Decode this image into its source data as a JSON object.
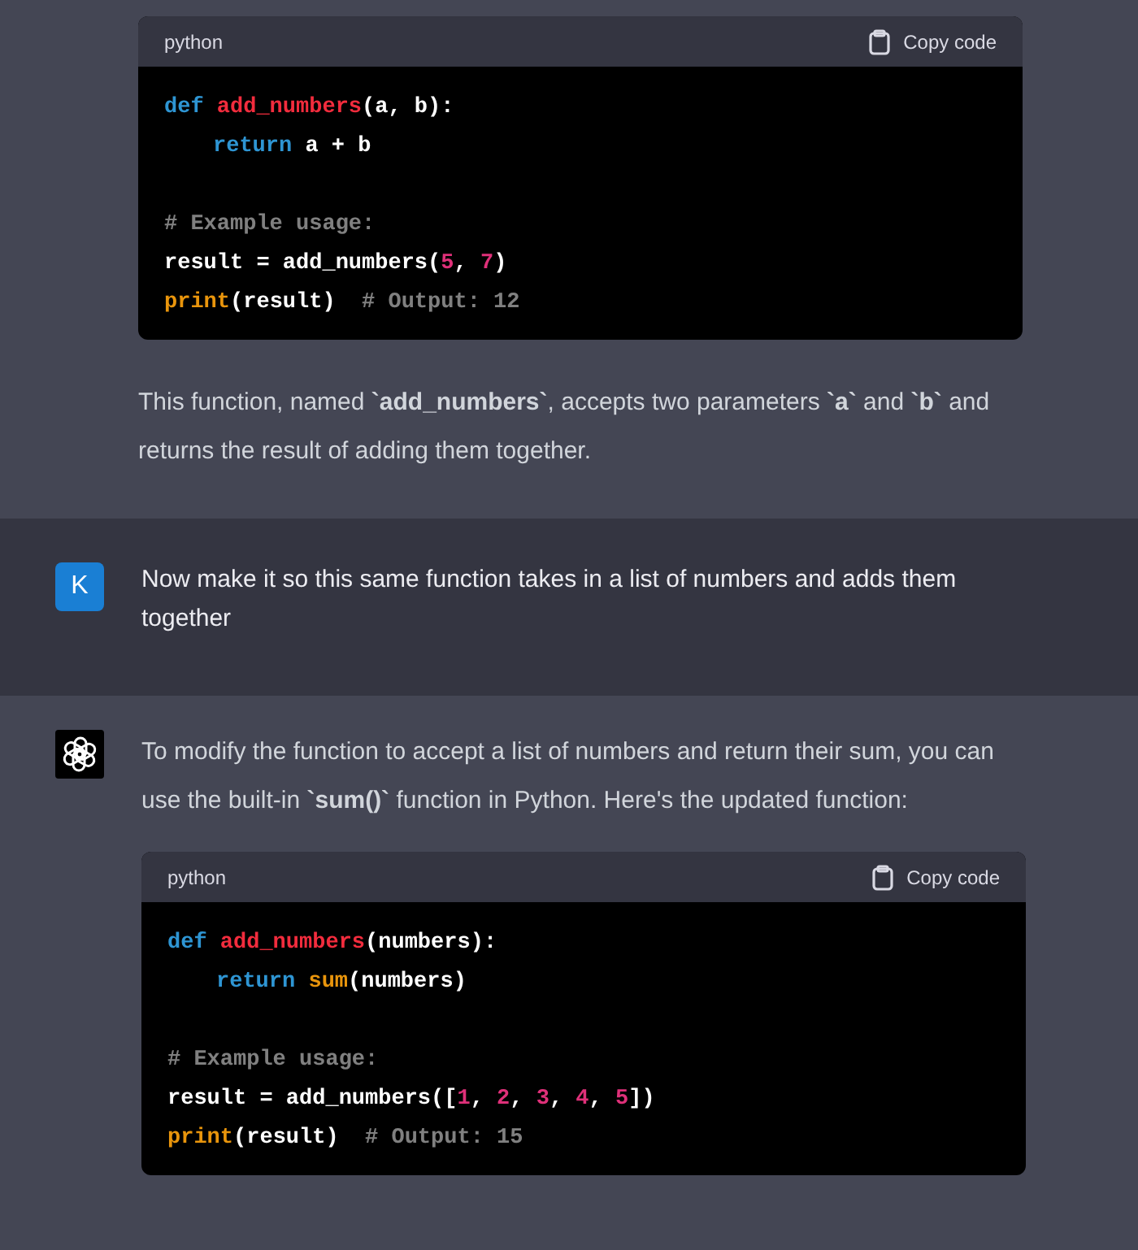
{
  "messages": [
    {
      "kind": "assistant",
      "blocks": [
        {
          "kind": "code",
          "language": "python",
          "copy_label": "Copy code",
          "lines": [
            {
              "kind": "code",
              "tokens": [
                {
                  "kind": "keyword",
                  "text": "def "
                },
                {
                  "kind": "function",
                  "text": "add_numbers"
                },
                {
                  "kind": "plain",
                  "text": "(a, b):"
                }
              ]
            },
            {
              "kind": "indented",
              "tokens": [
                {
                  "kind": "keyword",
                  "text": "return"
                },
                {
                  "kind": "plain",
                  "text": " a + b"
                }
              ]
            },
            {
              "kind": "blank"
            },
            {
              "kind": "code",
              "tokens": [
                {
                  "kind": "comment",
                  "text": "# Example usage:"
                }
              ]
            },
            {
              "kind": "code",
              "tokens": [
                {
                  "kind": "plain",
                  "text": "result = add_numbers("
                },
                {
                  "kind": "number",
                  "text": "5"
                },
                {
                  "kind": "plain",
                  "text": ", "
                },
                {
                  "kind": "number",
                  "text": "7"
                },
                {
                  "kind": "plain",
                  "text": ")"
                }
              ]
            },
            {
              "kind": "code",
              "tokens": [
                {
                  "kind": "builtin",
                  "text": "print"
                },
                {
                  "kind": "plain",
                  "text": "(result)  "
                },
                {
                  "kind": "comment",
                  "text": "# Output: 12"
                }
              ]
            }
          ]
        },
        {
          "kind": "paragraph",
          "text": "This function, named **`add_numbers`**, accepts two parameters **`a`** and **`b`** and returns the result of adding them together."
        }
      ]
    },
    {
      "kind": "user",
      "avatar": {
        "kind": "letter",
        "letter": "K"
      },
      "blocks": [
        {
          "kind": "paragraph",
          "text": "Now make it so this same function takes in a list of numbers and adds them together"
        }
      ]
    },
    {
      "kind": "assistant",
      "avatar": {
        "kind": "logo"
      },
      "blocks": [
        {
          "kind": "paragraph",
          "text": "To modify the function to accept a list of numbers and return their sum, you can use the built-in **`sum()`** function in Python. Here's the updated function:"
        },
        {
          "kind": "code",
          "language": "python",
          "copy_label": "Copy code",
          "lines": [
            {
              "kind": "code",
              "tokens": [
                {
                  "kind": "keyword",
                  "text": "def "
                },
                {
                  "kind": "function",
                  "text": "add_numbers"
                },
                {
                  "kind": "plain",
                  "text": "(numbers):"
                }
              ]
            },
            {
              "kind": "indented",
              "tokens": [
                {
                  "kind": "keyword",
                  "text": "return "
                },
                {
                  "kind": "builtin",
                  "text": "sum"
                },
                {
                  "kind": "plain",
                  "text": "(numbers)"
                }
              ]
            },
            {
              "kind": "blank"
            },
            {
              "kind": "code",
              "tokens": [
                {
                  "kind": "comment",
                  "text": "# Example usage:"
                }
              ]
            },
            {
              "kind": "code",
              "tokens": [
                {
                  "kind": "plain",
                  "text": "result = add_numbers(["
                },
                {
                  "kind": "number",
                  "text": "1"
                },
                {
                  "kind": "plain",
                  "text": ", "
                },
                {
                  "kind": "number",
                  "text": "2"
                },
                {
                  "kind": "plain",
                  "text": ", "
                },
                {
                  "kind": "number",
                  "text": "3"
                },
                {
                  "kind": "plain",
                  "text": ", "
                },
                {
                  "kind": "number",
                  "text": "4"
                },
                {
                  "kind": "plain",
                  "text": ", "
                },
                {
                  "kind": "number",
                  "text": "5"
                },
                {
                  "kind": "plain",
                  "text": "])"
                }
              ]
            },
            {
              "kind": "code",
              "tokens": [
                {
                  "kind": "builtin",
                  "text": "print"
                },
                {
                  "kind": "plain",
                  "text": "(result)  "
                },
                {
                  "kind": "comment",
                  "text": "# Output: 15"
                }
              ]
            }
          ]
        }
      ]
    }
  ]
}
